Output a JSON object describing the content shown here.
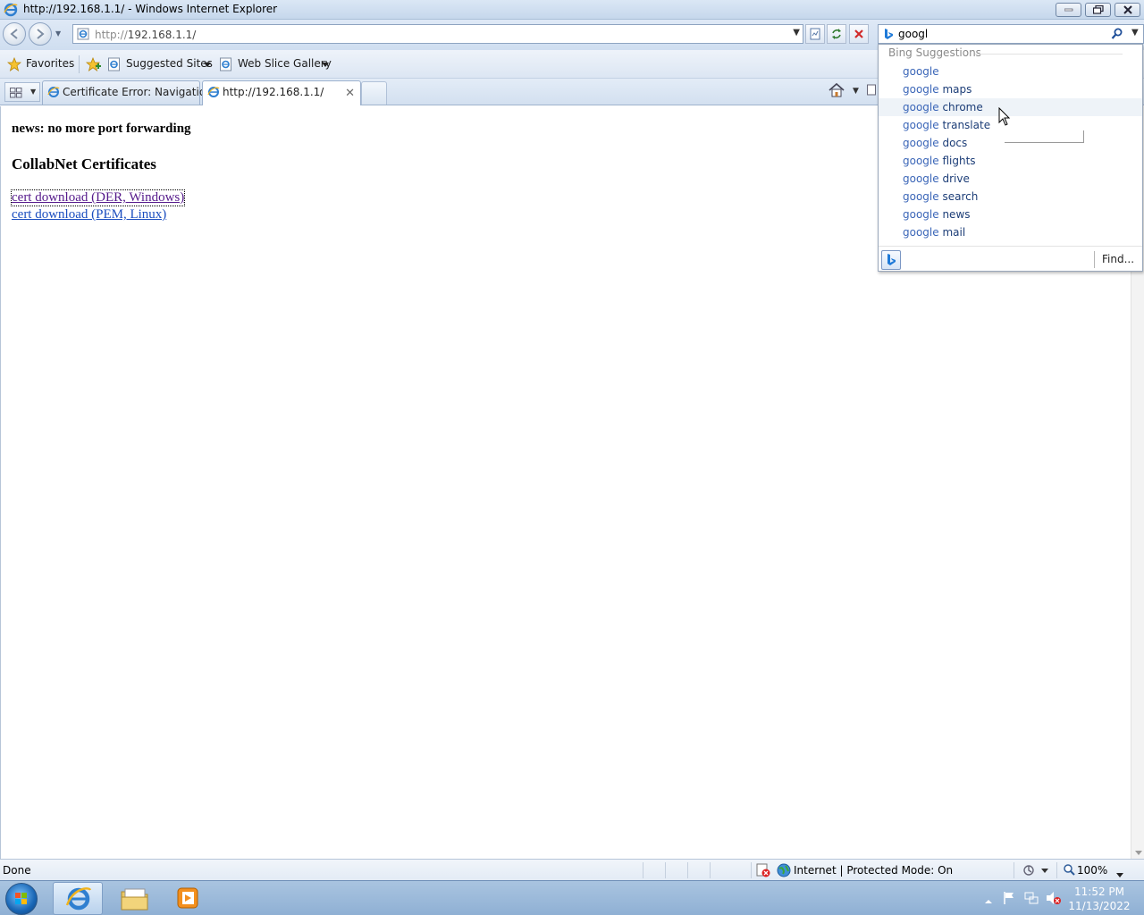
{
  "window": {
    "title": "http://192.168.1.1/ - Windows Internet Explorer"
  },
  "address_bar": {
    "url_scheme": "http://",
    "url_host": "192.168.1.1/"
  },
  "search": {
    "query": "googl",
    "suggestions_header": "Bing Suggestions",
    "suggestions": [
      {
        "query_part": "google",
        "rest": ""
      },
      {
        "query_part": "google",
        "rest": " maps"
      },
      {
        "query_part": "google",
        "rest": " chrome"
      },
      {
        "query_part": "google",
        "rest": " translate"
      },
      {
        "query_part": "google",
        "rest": " docs"
      },
      {
        "query_part": "google",
        "rest": " flights"
      },
      {
        "query_part": "google",
        "rest": " drive"
      },
      {
        "query_part": "google",
        "rest": " search"
      },
      {
        "query_part": "google",
        "rest": " news"
      },
      {
        "query_part": "google",
        "rest": " mail"
      }
    ],
    "highlighted_index": 2,
    "find_label": "Find..."
  },
  "favorites_bar": {
    "favorites_label": "Favorites",
    "suggested_sites_label": "Suggested Sites",
    "web_slice_label": "Web Slice Gallery"
  },
  "tabs": [
    {
      "label": "Certificate Error: Navigatio...",
      "active": false
    },
    {
      "label": "http://192.168.1.1/",
      "active": true
    }
  ],
  "page": {
    "news": "news: no more port forwarding",
    "heading": "CollabNet Certificates",
    "links": [
      "cert download (DER, Windows)",
      "cert download (PEM, Linux)"
    ]
  },
  "status_bar": {
    "status": "Done",
    "zone": "Internet | Protected Mode: On",
    "zoom": "100%"
  },
  "taskbar": {
    "time": "11:52 PM",
    "date": "11/13/2022"
  },
  "colors": {
    "visited_link": "#551a8b",
    "link": "#1a4dbf",
    "suggestion_query": "#3b66b8",
    "chrome_blue": "#c6d7ec"
  }
}
